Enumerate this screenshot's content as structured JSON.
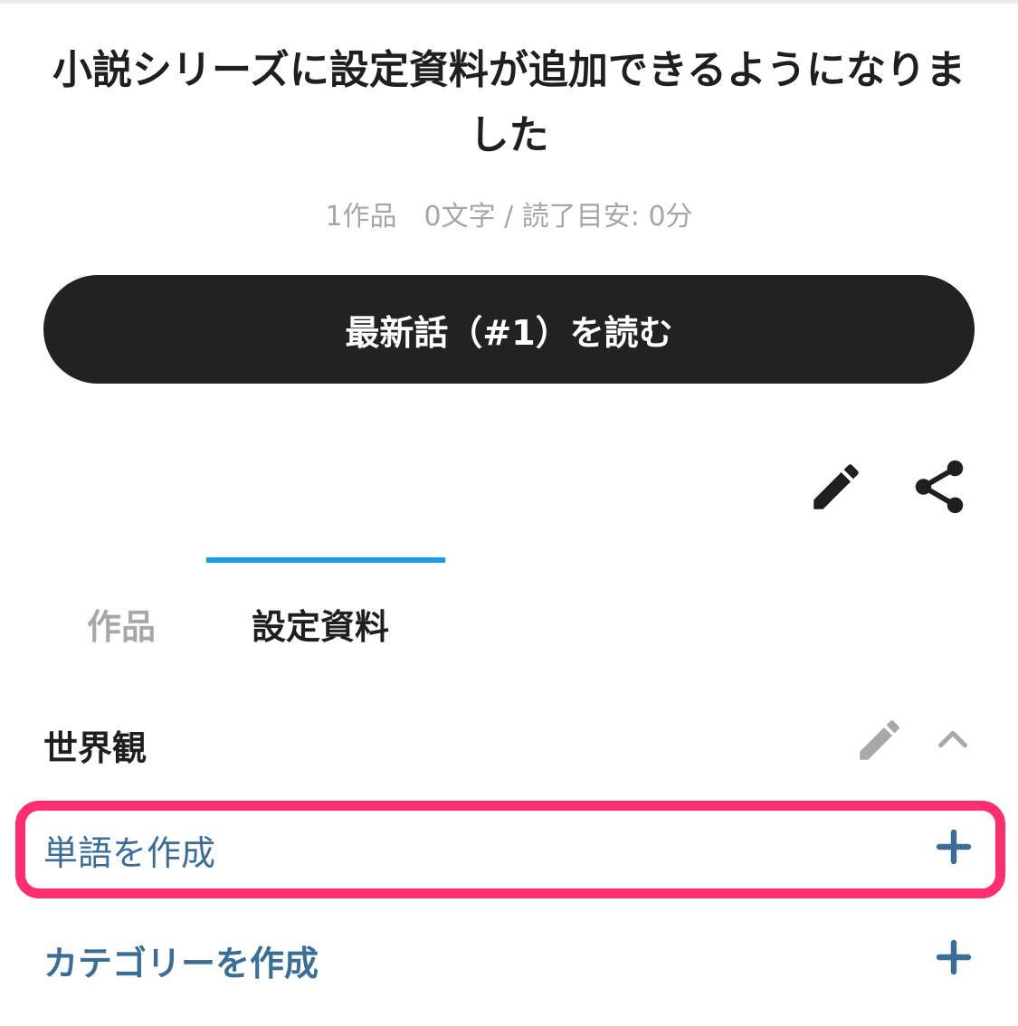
{
  "series": {
    "title": "小説シリーズに設定資料が追加できるようになりました",
    "meta": "1作品　0文字 / 読了目安: 0分"
  },
  "read_button": {
    "label": "最新話（#1）を読む"
  },
  "actions": {
    "edit_icon": "pencil-icon",
    "share_icon": "share-icon"
  },
  "tabs": [
    {
      "label": "作品",
      "active": false
    },
    {
      "label": "設定資料",
      "active": true
    }
  ],
  "section": {
    "title": "世界観",
    "edit_icon": "pencil-icon",
    "collapse_icon": "chevron-up-icon"
  },
  "rows": [
    {
      "label": "単語を作成",
      "icon": "plus-icon",
      "highlighted": true
    },
    {
      "label": "カテゴリーを作成",
      "icon": "plus-icon",
      "highlighted": false
    }
  ],
  "colors": {
    "accent": "#1a9be6",
    "link": "#3b6e96",
    "highlight": "#ff2e6e",
    "button": "#222222"
  }
}
